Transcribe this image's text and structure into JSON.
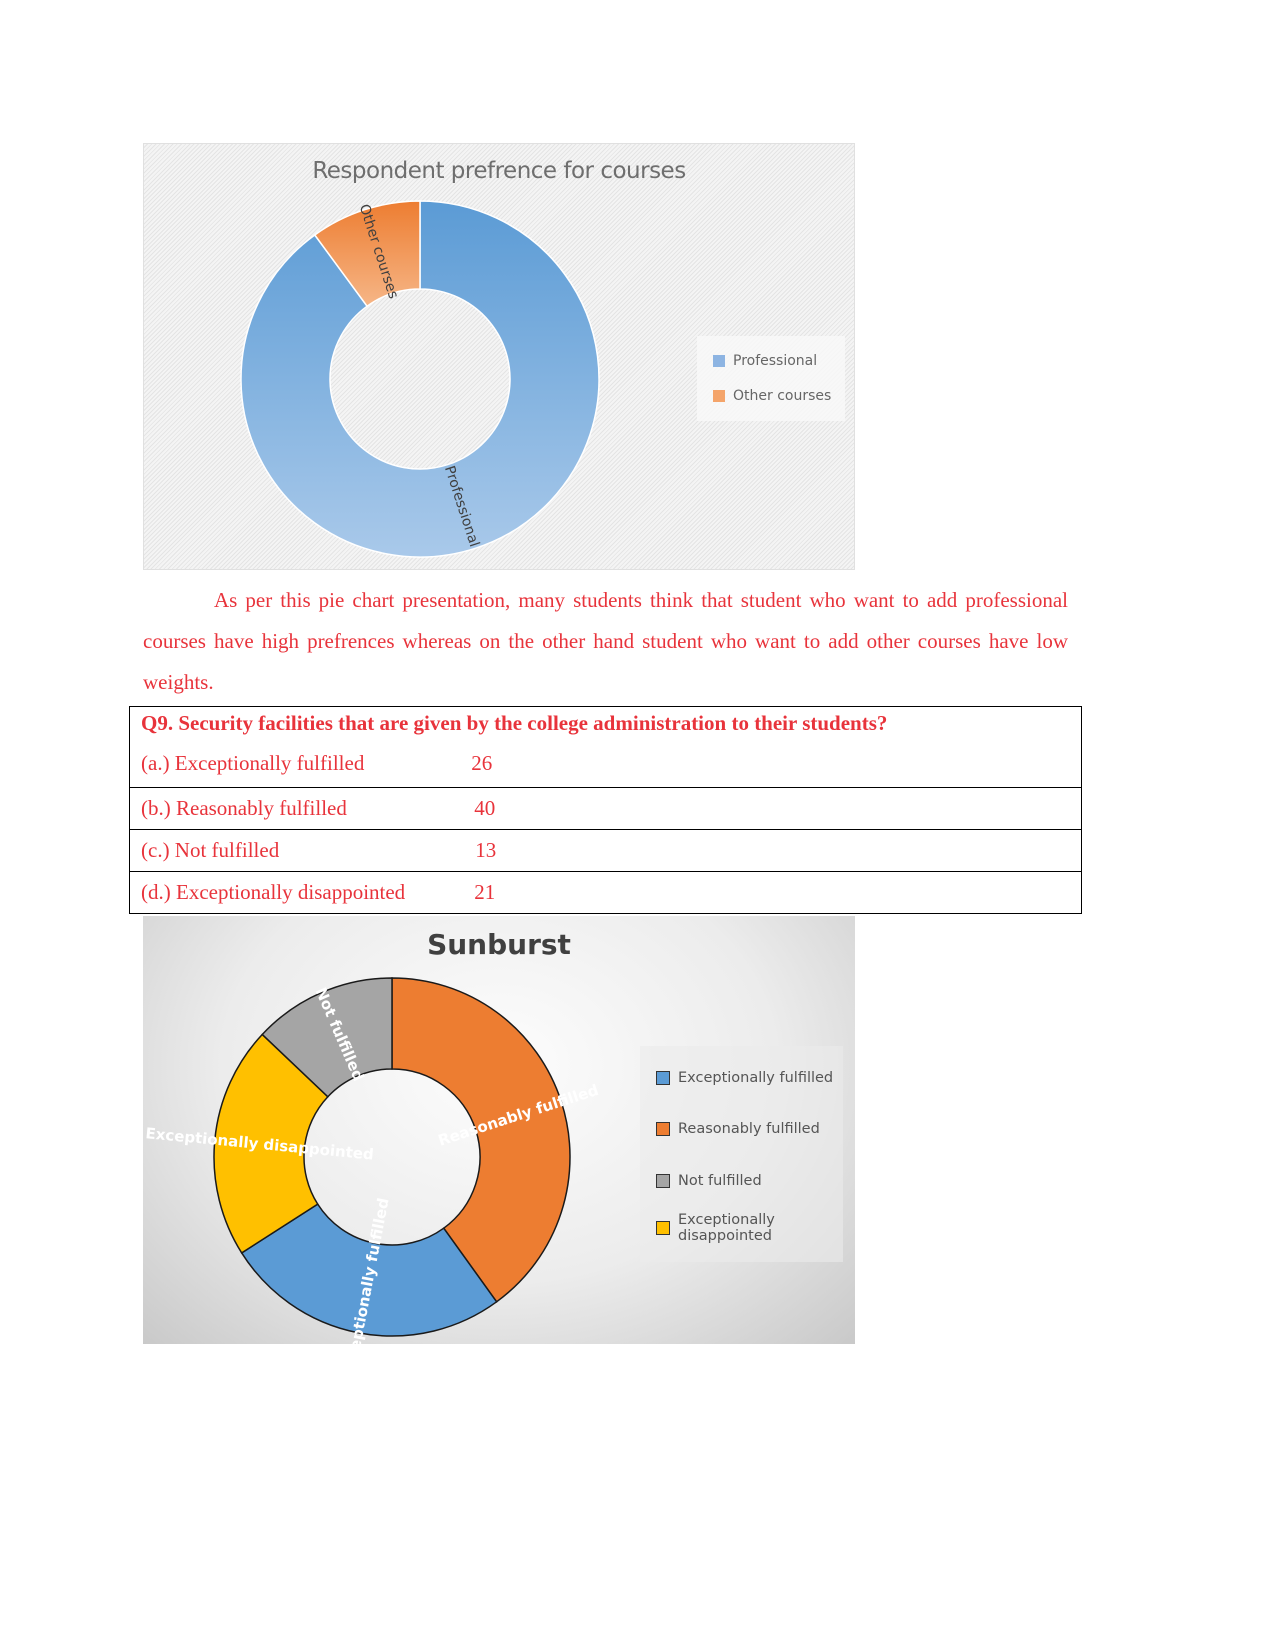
{
  "chart_data": [
    {
      "type": "pie",
      "variant": "donut",
      "title": "Respondent prefrence for courses",
      "categories": [
        "Professional",
        "Other courses"
      ],
      "values": [
        90,
        10
      ],
      "colors": [
        "#8db4e2",
        "#f4a46a"
      ],
      "slice_labels": [
        "Professional",
        "Other courses"
      ],
      "legend": {
        "placement": "right",
        "entries": [
          "Professional",
          "Other courses"
        ]
      }
    },
    {
      "type": "pie",
      "variant": "donut",
      "title": "Sunburst",
      "categories": [
        "Exceptionally fulfilled",
        "Reasonably fulfilled",
        "Not fulfilled",
        "Exceptionally disappointed"
      ],
      "values": [
        26,
        40,
        13,
        21
      ],
      "colors": [
        "#5b9bd5",
        "#ed7d31",
        "#a5a5a5",
        "#ffc000"
      ],
      "slice_labels": [
        "Exceptionally fulfilled",
        "Reasonably fulfilled",
        "Not fulfilled",
        "Exceptionally disappointed"
      ],
      "legend": {
        "placement": "right",
        "entries": [
          "Exceptionally fulfilled",
          "Reasonably fulfilled",
          "Not fulfilled",
          "Exceptionally disappointed"
        ]
      }
    }
  ],
  "paragraph": "As per this pie chart presentation, many students think that student who want to add professional courses have high prefrences whereas on the other hand student who want to add other courses have low weights.",
  "question": {
    "title": "Q9. Security facilities that are given by the college administration to their students?",
    "options": [
      {
        "label": "(a.) Exceptionally fulfilled",
        "count": "26"
      },
      {
        "label": "(b.) Reasonably fulfilled",
        "count": "40"
      },
      {
        "label": "(c.) Not fulfilled",
        "count": "13"
      },
      {
        "label": "(d.) Exceptionally disappointed",
        "count": "21"
      }
    ]
  }
}
